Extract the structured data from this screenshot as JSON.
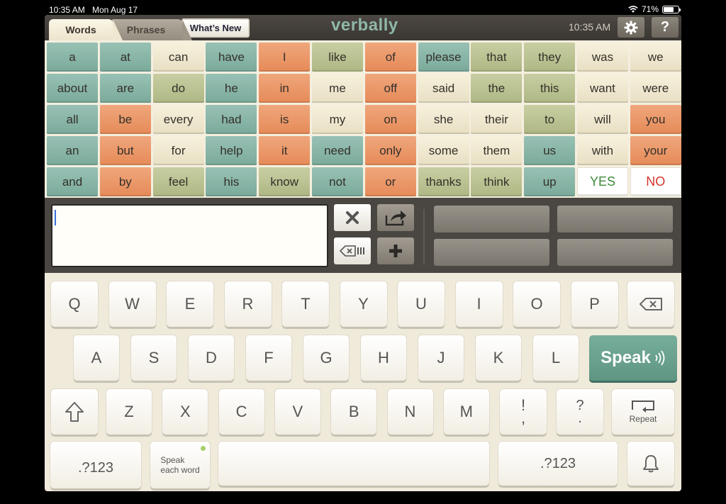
{
  "status": {
    "time": "10:35 AM",
    "date": "Mon Aug 17",
    "battery": "71%",
    "battery_level": 0.71
  },
  "header": {
    "tabs": [
      "Words",
      "Phrases"
    ],
    "whats_new": "What’s New",
    "logo": "verbally",
    "time": "10:35 AM",
    "settings_icon": "gear-icon",
    "help_label": "?"
  },
  "words": [
    {
      "t": "a",
      "c": "teal"
    },
    {
      "t": "at",
      "c": "teal"
    },
    {
      "t": "can",
      "c": "cream"
    },
    {
      "t": "have",
      "c": "teal"
    },
    {
      "t": "I",
      "c": "orange"
    },
    {
      "t": "like",
      "c": "olive"
    },
    {
      "t": "of",
      "c": "orange"
    },
    {
      "t": "please",
      "c": "teal"
    },
    {
      "t": "that",
      "c": "olive"
    },
    {
      "t": "they",
      "c": "olive"
    },
    {
      "t": "was",
      "c": "cream"
    },
    {
      "t": "we",
      "c": "cream"
    },
    {
      "t": "about",
      "c": "teal"
    },
    {
      "t": "are",
      "c": "teal"
    },
    {
      "t": "do",
      "c": "olive"
    },
    {
      "t": "he",
      "c": "teal"
    },
    {
      "t": "in",
      "c": "orange"
    },
    {
      "t": "me",
      "c": "cream"
    },
    {
      "t": "off",
      "c": "orange"
    },
    {
      "t": "said",
      "c": "cream"
    },
    {
      "t": "the",
      "c": "olive"
    },
    {
      "t": "this",
      "c": "olive"
    },
    {
      "t": "want",
      "c": "cream"
    },
    {
      "t": "were",
      "c": "cream"
    },
    {
      "t": "all",
      "c": "teal"
    },
    {
      "t": "be",
      "c": "orange"
    },
    {
      "t": "every",
      "c": "cream"
    },
    {
      "t": "had",
      "c": "teal"
    },
    {
      "t": "is",
      "c": "orange"
    },
    {
      "t": "my",
      "c": "cream"
    },
    {
      "t": "on",
      "c": "orange"
    },
    {
      "t": "she",
      "c": "cream"
    },
    {
      "t": "their",
      "c": "cream"
    },
    {
      "t": "to",
      "c": "olive"
    },
    {
      "t": "will",
      "c": "cream"
    },
    {
      "t": "you",
      "c": "orange"
    },
    {
      "t": "an",
      "c": "teal"
    },
    {
      "t": "but",
      "c": "orange"
    },
    {
      "t": "for",
      "c": "cream"
    },
    {
      "t": "help",
      "c": "teal"
    },
    {
      "t": "it",
      "c": "orange"
    },
    {
      "t": "need",
      "c": "teal"
    },
    {
      "t": "only",
      "c": "orange"
    },
    {
      "t": "some",
      "c": "cream"
    },
    {
      "t": "them",
      "c": "cream"
    },
    {
      "t": "us",
      "c": "teal"
    },
    {
      "t": "with",
      "c": "cream"
    },
    {
      "t": "your",
      "c": "orange"
    },
    {
      "t": "and",
      "c": "teal"
    },
    {
      "t": "by",
      "c": "orange"
    },
    {
      "t": "feel",
      "c": "olive"
    },
    {
      "t": "his",
      "c": "teal"
    },
    {
      "t": "know",
      "c": "olive"
    },
    {
      "t": "not",
      "c": "teal"
    },
    {
      "t": "or",
      "c": "orange"
    },
    {
      "t": "thanks",
      "c": "olive"
    },
    {
      "t": "think",
      "c": "olive"
    },
    {
      "t": "up",
      "c": "teal"
    },
    {
      "t": "YES",
      "c": "white",
      "fg": "#3f8a3a"
    },
    {
      "t": "NO",
      "c": "white",
      "fg": "#d6362e"
    }
  ],
  "controls": {
    "clear_icon": "close-icon",
    "share_icon": "share-icon",
    "delete_icon": "backspace-icon",
    "add_icon": "plus-icon"
  },
  "keyboard": {
    "row1": [
      "Q",
      "W",
      "E",
      "R",
      "T",
      "Y",
      "U",
      "I",
      "O",
      "P"
    ],
    "row2": [
      "A",
      "S",
      "D",
      "F",
      "G",
      "H",
      "J",
      "K",
      "L"
    ],
    "row3": [
      "Z",
      "X",
      "C",
      "V",
      "B",
      "N",
      "M"
    ],
    "excl_top": "!",
    "excl_bottom": ",",
    "quest_top": "?",
    "quest_bottom": ".",
    "speak": "Speak",
    "repeat": "Repeat",
    "numbers": ".?123",
    "speak_each_word": [
      "Speak",
      "each word"
    ],
    "accent": "#6aa290"
  }
}
